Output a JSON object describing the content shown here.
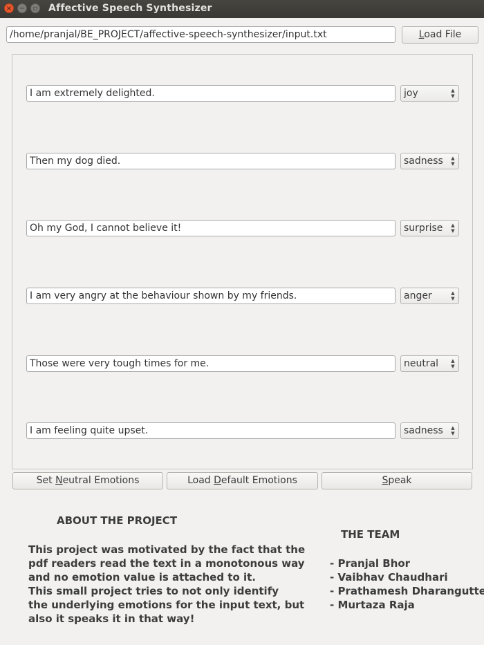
{
  "window": {
    "title": "Affective Speech Synthesizer"
  },
  "file": {
    "path": "/home/pranjal/BE_PROJECT/affective-speech-synthesizer/input.txt",
    "load_button_mnemonic": "L",
    "load_button_rest": "oad File"
  },
  "rows": [
    {
      "text": "I am extremely delighted.",
      "emotion": "joy"
    },
    {
      "text": "Then my dog died.",
      "emotion": "sadness"
    },
    {
      "text": "Oh my God, I cannot believe it!",
      "emotion": "surprise"
    },
    {
      "text": "I am very angry at the behaviour shown by my friends.",
      "emotion": "anger"
    },
    {
      "text": "Those were very tough times for me.",
      "emotion": "neutral"
    },
    {
      "text": "I am feeling quite upset.",
      "emotion": "sadness"
    }
  ],
  "actions": {
    "neutral": {
      "pre": "Set ",
      "mnemonic": "N",
      "post": "eutral Emotions"
    },
    "default": {
      "pre": "Load ",
      "mnemonic": "D",
      "post": "efault Emotions"
    },
    "speak": {
      "pre": "",
      "mnemonic": "S",
      "post": "peak"
    }
  },
  "about": {
    "heading": "ABOUT THE PROJECT",
    "lines": [
      "This project was motivated by the fact that the",
      "pdf readers read the text in a monotonous way",
      "and no emotion value is attached to it.",
      "This small project tries to not only identify",
      "the underlying emotions for the input text, but",
      "also it speaks it in that way!"
    ]
  },
  "team": {
    "heading": "THE TEAM",
    "members": [
      "- Pranjal Bhor",
      "- Vaibhav Chaudhari",
      "- Prathamesh Dharangutte",
      "- Murtaza Raja"
    ]
  },
  "icons": {
    "close": "close-icon",
    "minimize": "minimize-icon",
    "maximize": "maximize-icon",
    "combo_arrows": "updown-arrows-icon"
  },
  "colors": {
    "titlebar": "#3c3b37",
    "close_button": "#e9582d",
    "window_bg": "#f2f1f0"
  }
}
